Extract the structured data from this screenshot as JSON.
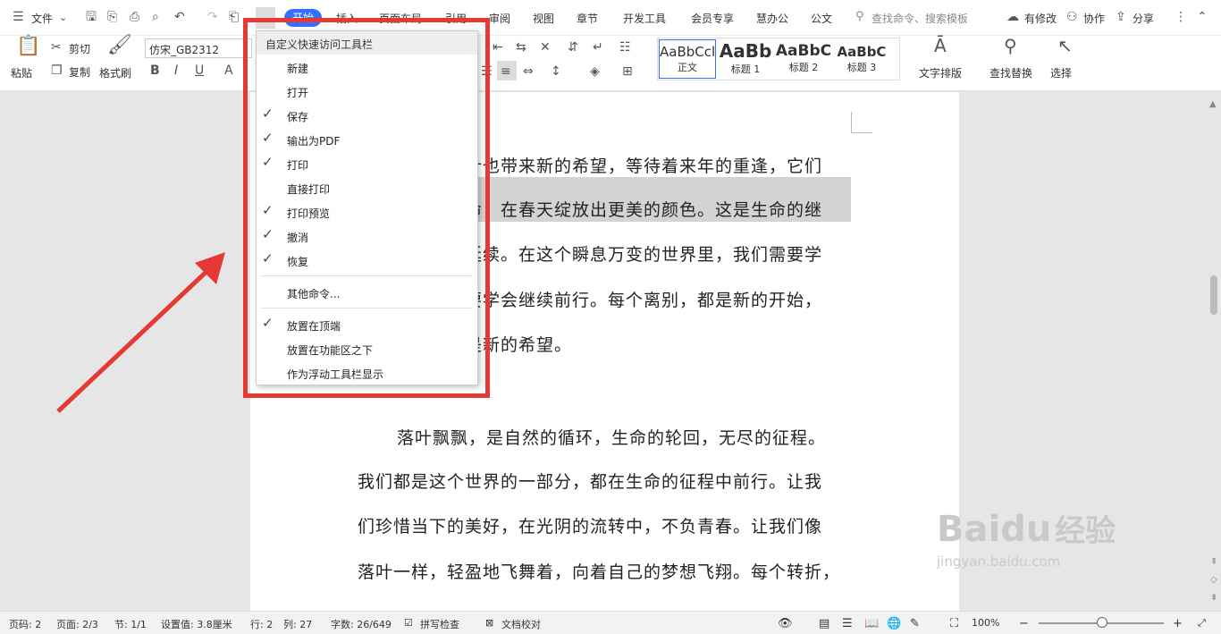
{
  "menubar": {
    "file": "文件",
    "tabs": [
      "开始",
      "插入",
      "页面布局",
      "引用",
      "审阅",
      "视图",
      "章节",
      "开发工具",
      "会员专享",
      "慧办公",
      "公文"
    ],
    "search": "查找命令、搜索模板",
    "modified": "有修改",
    "collab": "协作",
    "share": "分享"
  },
  "ribbon": {
    "paste": "粘贴",
    "cut": "剪切",
    "copy": "复制",
    "format_painter": "格式刷",
    "font_name": "仿宋_GB2312",
    "styles": [
      {
        "preview": "AaBbCcl",
        "name": "正文"
      },
      {
        "preview": "AaBb",
        "name": "标题 1"
      },
      {
        "preview": "AaBbC",
        "name": "标题 2"
      },
      {
        "preview": "AaBbC",
        "name": "标题 3"
      }
    ],
    "text_layout": "文字排版",
    "find_replace": "查找替换",
    "select": "选择"
  },
  "document": {
    "lines": [
      "叶也带来新的希望，等待着来年的重逢，它们",
      "命，在春天绽放出更美的颜色。这是生命的继",
      "延续。在这个瞬息万变的世界里，我们需要学",
      "要学会继续前行。每个离别，都是新的开始，",
      "是新的希望。",
      "落叶飘飘，是自然的循环，生命的轮回，无尽的征程。",
      "我们都是这个世界的一部分，都在生命的征程中前行。让我",
      "们珍惜当下的美好，在光阴的流转中，不负青春。让我们像",
      "落叶一样，轻盈地飞舞着，向着自己的梦想飞翔。每个转折，"
    ]
  },
  "dropdown": {
    "title": "自定义快速访问工具栏",
    "items": [
      {
        "label": "新建",
        "checked": false
      },
      {
        "label": "打开",
        "checked": false
      },
      {
        "label": "保存",
        "checked": true
      },
      {
        "label": "输出为PDF",
        "checked": true
      },
      {
        "label": "打印",
        "checked": true
      },
      {
        "label": "直接打印",
        "checked": false
      },
      {
        "label": "打印预览",
        "checked": true
      },
      {
        "label": "撤消",
        "checked": true
      },
      {
        "label": "恢复",
        "checked": true
      }
    ],
    "other": "其他命令...",
    "positions": [
      {
        "label": "放置在顶端",
        "checked": true
      },
      {
        "label": "放置在功能区之下",
        "checked": false
      },
      {
        "label": "作为浮动工具栏显示",
        "checked": false
      }
    ]
  },
  "statusbar": {
    "page_num": "页码: 2",
    "pages": "页面: 2/3",
    "section": "节: 1/1",
    "setting": "设置值: 3.8厘米",
    "row": "行: 2",
    "col": "列: 27",
    "words": "字数: 26/649",
    "spell": "拼写检查",
    "proof": "文档校对",
    "zoom": "100%"
  },
  "watermark": {
    "brand": "Baidu",
    "cn": "经验",
    "url": "jingyan.baidu.com"
  },
  "colors": {
    "accent": "#3370ff",
    "highlight": "#d3d3d3",
    "annotation": "#e53935"
  }
}
